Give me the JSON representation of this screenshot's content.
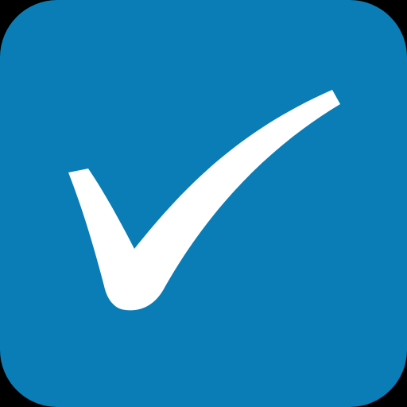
{
  "app_icon": {
    "icon_name": "checkmark-icon",
    "colors": {
      "background": "#000000",
      "tile": "#0A7DB6",
      "check": "#FFFFFF"
    }
  }
}
